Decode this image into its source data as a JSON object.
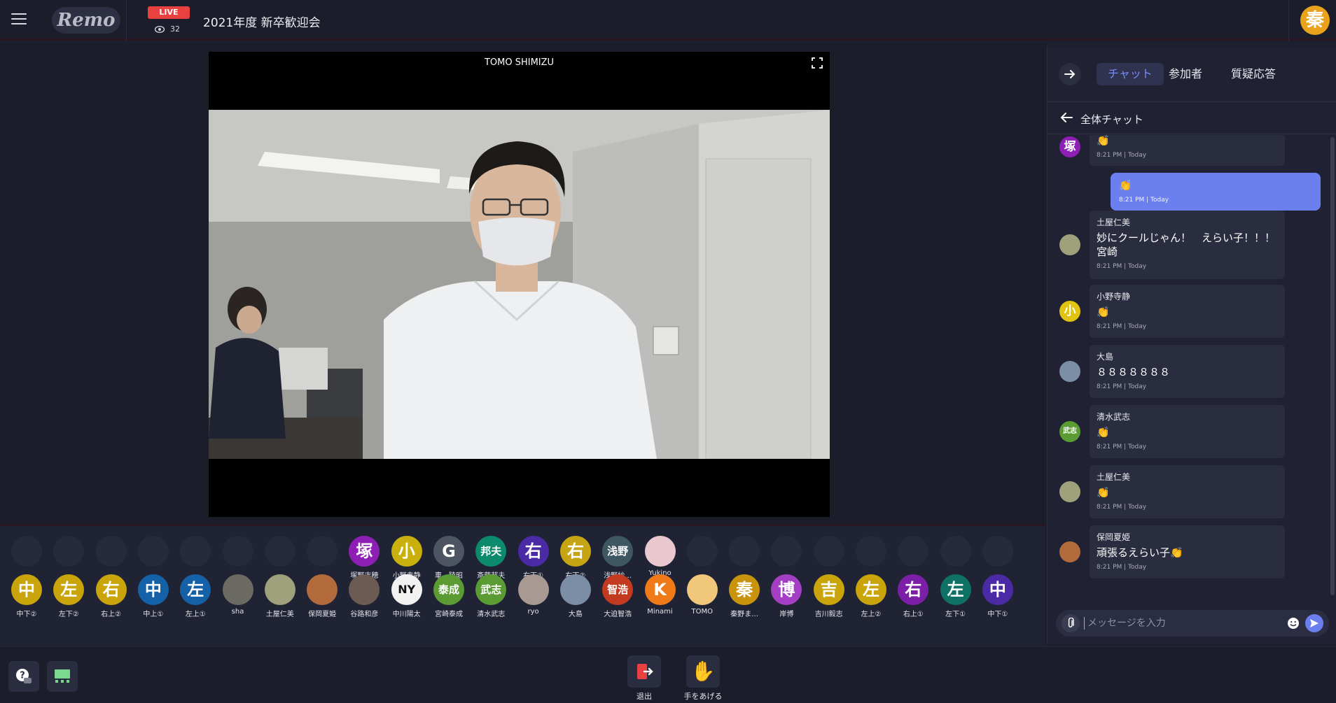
{
  "topbar": {
    "logo": "Remo",
    "live_label": "LIVE",
    "viewer_count": "32",
    "event_title": "2021年度 新卒歓迎会",
    "me_avatar": "秦",
    "me_color": "#e9a21c"
  },
  "stage": {
    "presenter_name": "TOMO SHIMIZU"
  },
  "attendees": {
    "row1": [
      {
        "name": "",
        "glyph": "",
        "color": ""
      },
      {
        "name": "",
        "glyph": "",
        "color": ""
      },
      {
        "name": "",
        "glyph": "",
        "color": ""
      },
      {
        "name": "",
        "glyph": "",
        "color": ""
      },
      {
        "name": "",
        "glyph": "",
        "color": ""
      },
      {
        "name": "",
        "glyph": "",
        "color": ""
      },
      {
        "name": "",
        "glyph": "",
        "color": ""
      },
      {
        "name": "",
        "glyph": "",
        "color": ""
      },
      {
        "name": "塚野志穂",
        "glyph": "塚",
        "color": "#8d1fb5"
      },
      {
        "name": "小野寺静",
        "glyph": "小",
        "color": "#c9b00d"
      },
      {
        "name": "車　陸昭",
        "glyph": "G",
        "color": "#4d5562"
      },
      {
        "name": "斎藤邦夫",
        "glyph": "邦夫",
        "color": "#0c8a6c"
      },
      {
        "name": "右下①",
        "glyph": "右",
        "color": "#4b2aa6"
      },
      {
        "name": "右下②",
        "glyph": "右",
        "color": "#c7a414"
      },
      {
        "name": "浅野紗…",
        "glyph": "浅野",
        "color": "#3f5663"
      },
      {
        "name": "Yukino",
        "glyph": "",
        "color": "#e9c9cf"
      },
      {
        "name": "",
        "glyph": "",
        "color": ""
      },
      {
        "name": "",
        "glyph": "",
        "color": ""
      },
      {
        "name": "",
        "glyph": "",
        "color": ""
      },
      {
        "name": "",
        "glyph": "",
        "color": ""
      },
      {
        "name": "",
        "glyph": "",
        "color": ""
      },
      {
        "name": "",
        "glyph": "",
        "color": ""
      },
      {
        "name": "",
        "glyph": "",
        "color": ""
      },
      {
        "name": "",
        "glyph": "",
        "color": ""
      }
    ],
    "row2": [
      {
        "name": "中下②",
        "glyph": "中",
        "color": "#c9a40b"
      },
      {
        "name": "左下②",
        "glyph": "左",
        "color": "#c9a40b"
      },
      {
        "name": "右上②",
        "glyph": "右",
        "color": "#c9a40b"
      },
      {
        "name": "中上①",
        "glyph": "中",
        "color": "#1561a8"
      },
      {
        "name": "左上①",
        "glyph": "左",
        "color": "#1561a8"
      },
      {
        "name": "sha",
        "glyph": "",
        "color": "#6b6b63"
      },
      {
        "name": "土屋仁美",
        "glyph": "",
        "color": "#9ea17b"
      },
      {
        "name": "保岡夏姫",
        "glyph": "",
        "color": "#b36a3c"
      },
      {
        "name": "谷路和彦",
        "glyph": "",
        "color": "#6c5b52"
      },
      {
        "name": "中川陽太",
        "glyph": "NY",
        "color": "#f2f2f2"
      },
      {
        "name": "宮崎泰成",
        "glyph": "泰成",
        "color": "#5b9b33"
      },
      {
        "name": "清水武志",
        "glyph": "武志",
        "color": "#5b9b33"
      },
      {
        "name": "ryo",
        "glyph": "",
        "color": "#a89a92"
      },
      {
        "name": "大島",
        "glyph": "",
        "color": "#7c8ea5"
      },
      {
        "name": "大迫智浩",
        "glyph": "智浩",
        "color": "#c23a1f"
      },
      {
        "name": "Minami",
        "glyph": "K",
        "color": "#ef7a17"
      },
      {
        "name": "TOMO",
        "glyph": "",
        "color": "#f0c77b"
      },
      {
        "name": "秦野ま…",
        "glyph": "秦",
        "color": "#c9930b"
      },
      {
        "name": "岸博",
        "glyph": "博",
        "color": "#a43fc4"
      },
      {
        "name": "吉川毅志",
        "glyph": "吉",
        "color": "#c9a40b"
      },
      {
        "name": "左上②",
        "glyph": "左",
        "color": "#c9a40b"
      },
      {
        "name": "右上①",
        "glyph": "右",
        "color": "#7b1fa6"
      },
      {
        "name": "左下①",
        "glyph": "左",
        "color": "#0f7065"
      },
      {
        "name": "中下①",
        "glyph": "中",
        "color": "#4b2aa6"
      }
    ]
  },
  "bottombar": {
    "exit_label": "退出",
    "raise_hand_label": "手をあげる"
  },
  "chat": {
    "tabs": [
      "チャット",
      "参加者",
      "質疑応答"
    ],
    "active_tab": 0,
    "subtitle": "全体チャット",
    "input_placeholder": "メッセージを入力",
    "messages": [
      {
        "own": false,
        "sender": "",
        "text": "👏",
        "time": "8:21 PM | Today",
        "avatar_glyph": "塚",
        "avatar_color": "#8d1fb5"
      },
      {
        "own": true,
        "sender": "",
        "text": "👏",
        "time": "8:21 PM | Today",
        "avatar_glyph": "",
        "avatar_color": ""
      },
      {
        "own": false,
        "sender": "土屋仁美",
        "text": "妙にクールじゃん！　えらい子！！！宮崎",
        "time": "8:21 PM | Today",
        "avatar_glyph": "",
        "avatar_color": "#9ea17b"
      },
      {
        "own": false,
        "sender": "小野寺静",
        "text": "👏",
        "time": "8:21 PM | Today",
        "avatar_glyph": "小",
        "avatar_color": "#e0c40f"
      },
      {
        "own": false,
        "sender": "大島",
        "text": "８８８８８８８",
        "time": "8:21 PM | Today",
        "avatar_glyph": "",
        "avatar_color": "#7c8ea5"
      },
      {
        "own": false,
        "sender": "清水武志",
        "text": "👏",
        "time": "8:21 PM | Today",
        "avatar_glyph": "武志",
        "avatar_color": "#5b9b33"
      },
      {
        "own": false,
        "sender": "土屋仁美",
        "text": "👏",
        "time": "8:21 PM | Today",
        "avatar_glyph": "",
        "avatar_color": "#9ea17b"
      },
      {
        "own": false,
        "sender": "保岡夏姫",
        "text": "頑張るえらい子👏",
        "time": "8:21 PM | Today",
        "avatar_glyph": "",
        "avatar_color": "#b36a3c"
      }
    ]
  }
}
